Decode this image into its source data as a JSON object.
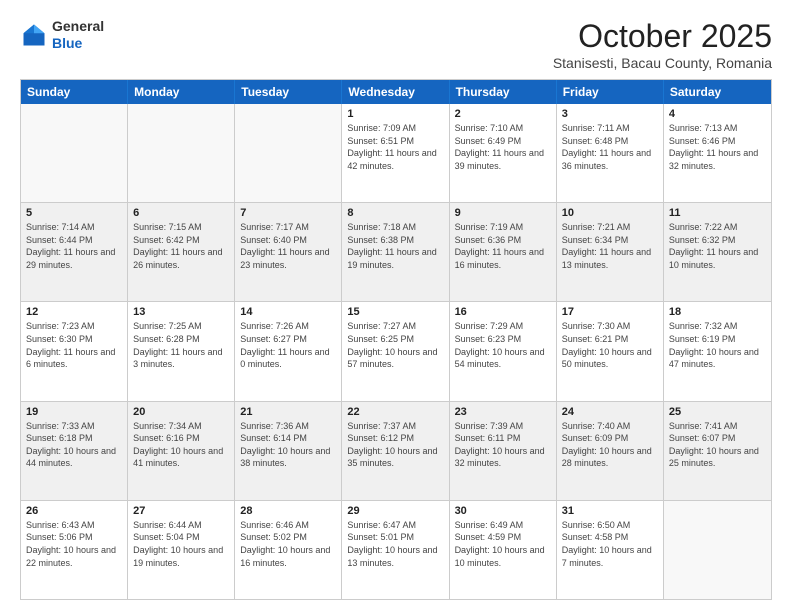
{
  "header": {
    "logo_general": "General",
    "logo_blue": "Blue",
    "month": "October 2025",
    "location": "Stanisesti, Bacau County, Romania"
  },
  "weekdays": [
    "Sunday",
    "Monday",
    "Tuesday",
    "Wednesday",
    "Thursday",
    "Friday",
    "Saturday"
  ],
  "rows": [
    [
      {
        "day": "",
        "info": ""
      },
      {
        "day": "",
        "info": ""
      },
      {
        "day": "",
        "info": ""
      },
      {
        "day": "1",
        "info": "Sunrise: 7:09 AM\nSunset: 6:51 PM\nDaylight: 11 hours and 42 minutes."
      },
      {
        "day": "2",
        "info": "Sunrise: 7:10 AM\nSunset: 6:49 PM\nDaylight: 11 hours and 39 minutes."
      },
      {
        "day": "3",
        "info": "Sunrise: 7:11 AM\nSunset: 6:48 PM\nDaylight: 11 hours and 36 minutes."
      },
      {
        "day": "4",
        "info": "Sunrise: 7:13 AM\nSunset: 6:46 PM\nDaylight: 11 hours and 32 minutes."
      }
    ],
    [
      {
        "day": "5",
        "info": "Sunrise: 7:14 AM\nSunset: 6:44 PM\nDaylight: 11 hours and 29 minutes."
      },
      {
        "day": "6",
        "info": "Sunrise: 7:15 AM\nSunset: 6:42 PM\nDaylight: 11 hours and 26 minutes."
      },
      {
        "day": "7",
        "info": "Sunrise: 7:17 AM\nSunset: 6:40 PM\nDaylight: 11 hours and 23 minutes."
      },
      {
        "day": "8",
        "info": "Sunrise: 7:18 AM\nSunset: 6:38 PM\nDaylight: 11 hours and 19 minutes."
      },
      {
        "day": "9",
        "info": "Sunrise: 7:19 AM\nSunset: 6:36 PM\nDaylight: 11 hours and 16 minutes."
      },
      {
        "day": "10",
        "info": "Sunrise: 7:21 AM\nSunset: 6:34 PM\nDaylight: 11 hours and 13 minutes."
      },
      {
        "day": "11",
        "info": "Sunrise: 7:22 AM\nSunset: 6:32 PM\nDaylight: 11 hours and 10 minutes."
      }
    ],
    [
      {
        "day": "12",
        "info": "Sunrise: 7:23 AM\nSunset: 6:30 PM\nDaylight: 11 hours and 6 minutes."
      },
      {
        "day": "13",
        "info": "Sunrise: 7:25 AM\nSunset: 6:28 PM\nDaylight: 11 hours and 3 minutes."
      },
      {
        "day": "14",
        "info": "Sunrise: 7:26 AM\nSunset: 6:27 PM\nDaylight: 11 hours and 0 minutes."
      },
      {
        "day": "15",
        "info": "Sunrise: 7:27 AM\nSunset: 6:25 PM\nDaylight: 10 hours and 57 minutes."
      },
      {
        "day": "16",
        "info": "Sunrise: 7:29 AM\nSunset: 6:23 PM\nDaylight: 10 hours and 54 minutes."
      },
      {
        "day": "17",
        "info": "Sunrise: 7:30 AM\nSunset: 6:21 PM\nDaylight: 10 hours and 50 minutes."
      },
      {
        "day": "18",
        "info": "Sunrise: 7:32 AM\nSunset: 6:19 PM\nDaylight: 10 hours and 47 minutes."
      }
    ],
    [
      {
        "day": "19",
        "info": "Sunrise: 7:33 AM\nSunset: 6:18 PM\nDaylight: 10 hours and 44 minutes."
      },
      {
        "day": "20",
        "info": "Sunrise: 7:34 AM\nSunset: 6:16 PM\nDaylight: 10 hours and 41 minutes."
      },
      {
        "day": "21",
        "info": "Sunrise: 7:36 AM\nSunset: 6:14 PM\nDaylight: 10 hours and 38 minutes."
      },
      {
        "day": "22",
        "info": "Sunrise: 7:37 AM\nSunset: 6:12 PM\nDaylight: 10 hours and 35 minutes."
      },
      {
        "day": "23",
        "info": "Sunrise: 7:39 AM\nSunset: 6:11 PM\nDaylight: 10 hours and 32 minutes."
      },
      {
        "day": "24",
        "info": "Sunrise: 7:40 AM\nSunset: 6:09 PM\nDaylight: 10 hours and 28 minutes."
      },
      {
        "day": "25",
        "info": "Sunrise: 7:41 AM\nSunset: 6:07 PM\nDaylight: 10 hours and 25 minutes."
      }
    ],
    [
      {
        "day": "26",
        "info": "Sunrise: 6:43 AM\nSunset: 5:06 PM\nDaylight: 10 hours and 22 minutes."
      },
      {
        "day": "27",
        "info": "Sunrise: 6:44 AM\nSunset: 5:04 PM\nDaylight: 10 hours and 19 minutes."
      },
      {
        "day": "28",
        "info": "Sunrise: 6:46 AM\nSunset: 5:02 PM\nDaylight: 10 hours and 16 minutes."
      },
      {
        "day": "29",
        "info": "Sunrise: 6:47 AM\nSunset: 5:01 PM\nDaylight: 10 hours and 13 minutes."
      },
      {
        "day": "30",
        "info": "Sunrise: 6:49 AM\nSunset: 4:59 PM\nDaylight: 10 hours and 10 minutes."
      },
      {
        "day": "31",
        "info": "Sunrise: 6:50 AM\nSunset: 4:58 PM\nDaylight: 10 hours and 7 minutes."
      },
      {
        "day": "",
        "info": ""
      }
    ]
  ]
}
